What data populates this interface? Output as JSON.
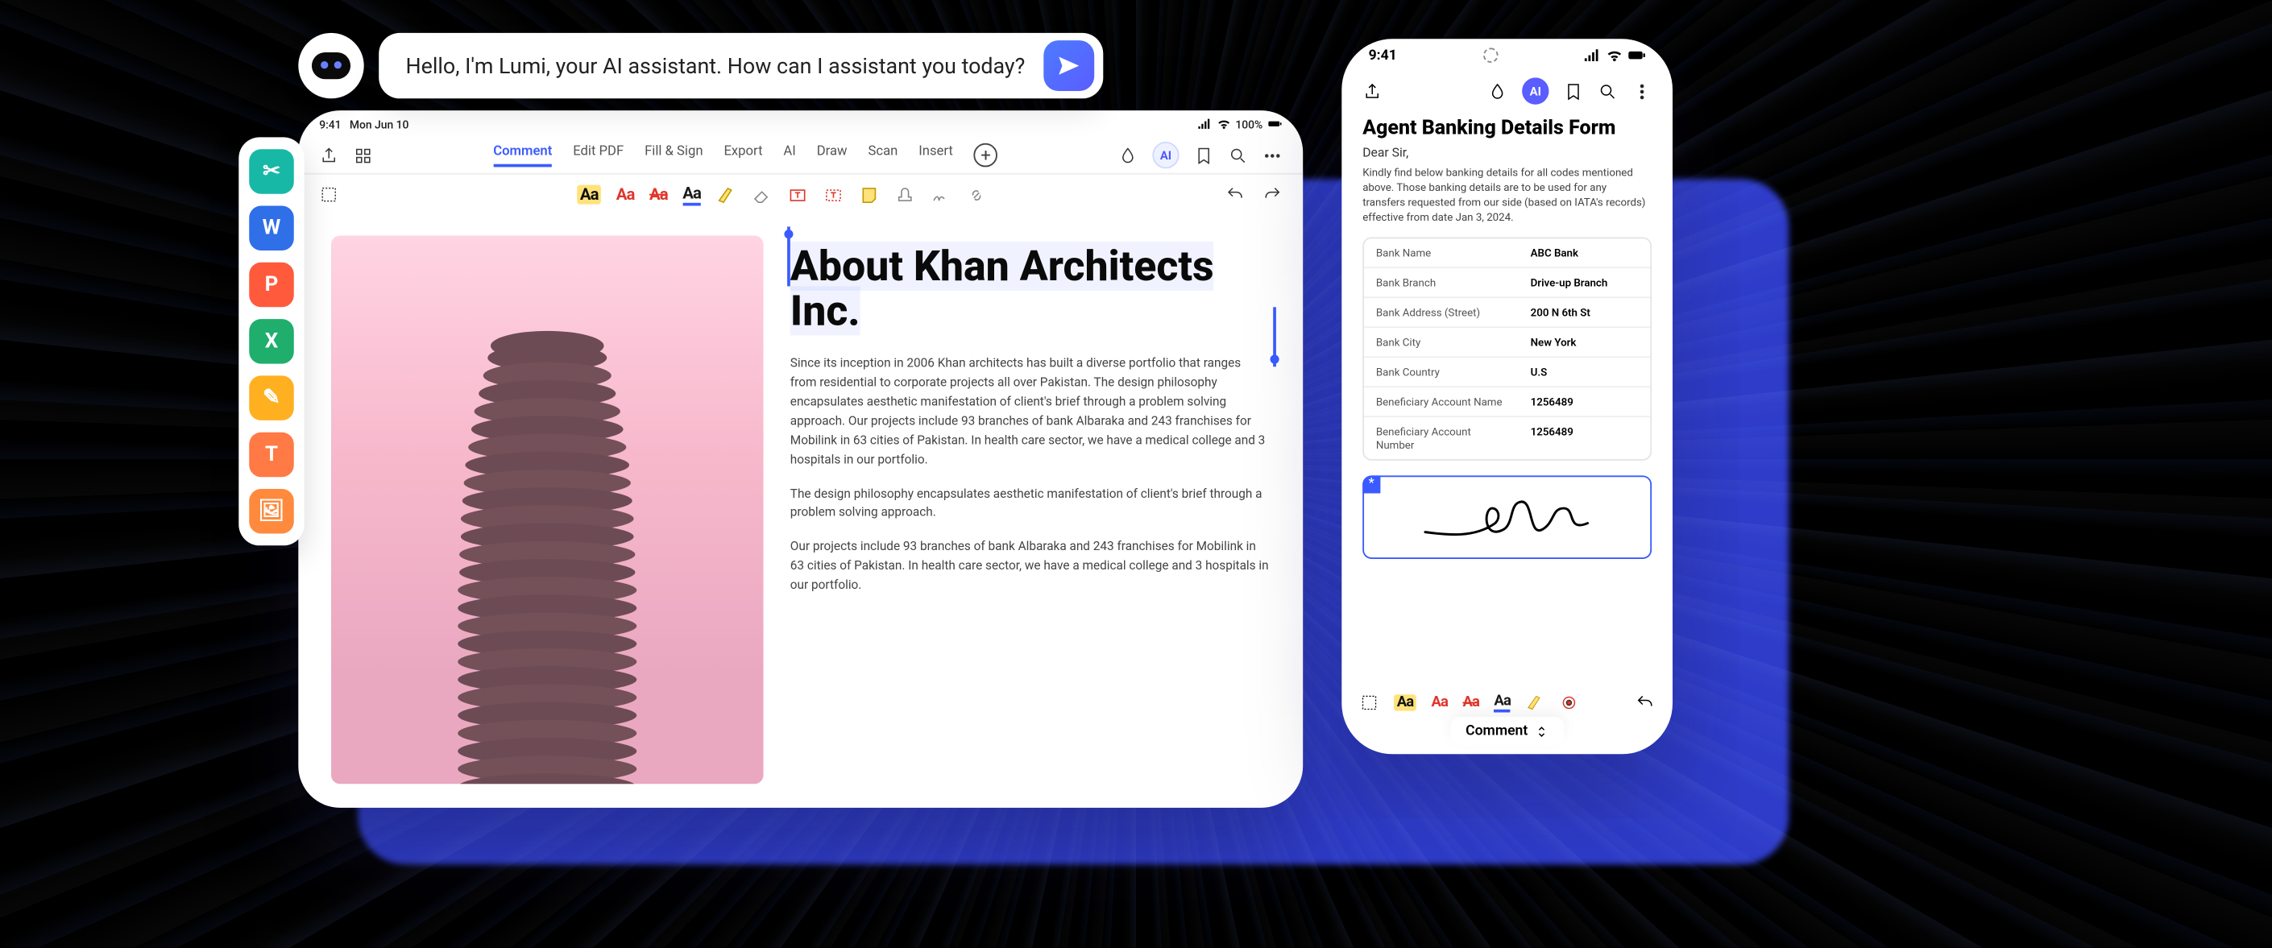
{
  "ai": {
    "greeting": "Hello, I'm Lumi, your AI assistant. How can I assistant you today?"
  },
  "dock": {
    "items": [
      {
        "label": "✂",
        "bg": "#17b8a6"
      },
      {
        "label": "W",
        "bg": "#2f6fe8"
      },
      {
        "label": "P",
        "bg": "#ff5a3c"
      },
      {
        "label": "X",
        "bg": "#1fae6c"
      },
      {
        "label": "✎",
        "bg": "#ffb021"
      },
      {
        "label": "T",
        "bg": "#ff7a45"
      },
      {
        "label": "🖼",
        "bg": "#ff8a3d"
      }
    ]
  },
  "tablet": {
    "status": {
      "time": "9:41",
      "date": "Mon Jun 10",
      "battery": "100%"
    },
    "header": {
      "tabs": [
        "Comment",
        "Edit PDF",
        "Fill & Sign",
        "Export",
        "AI",
        "Draw",
        "Scan",
        "Insert"
      ],
      "active_index": 0,
      "ai_badge": "AI"
    },
    "document": {
      "title": "About Khan Architects Inc.",
      "p1": "Since its inception in 2006 Khan architects has built a diverse portfolio that ranges from residential to corporate projects all over Pakistan. The design philosophy encapsulates aesthetic manifestation of client's brief through a problem solving approach. Our projects include 93 branches of bank Albaraka and 243 franchises for Mobilink in 63 cities of Pakistan. In health care sector, we have a medical college and 3 hospitals in our portfolio.",
      "p2": "The design philosophy encapsulates aesthetic manifestation of client's brief through a problem solving approach.",
      "p3": "Our projects include 93 branches of bank Albaraka and 243 franchises for Mobilink in 63 cities of Pakistan. In health care sector, we have a medical college and 3 hospitals in our portfolio."
    }
  },
  "phone": {
    "status_time": "9:41",
    "title": "Agent Banking Details Form",
    "dear": "Dear Sir,",
    "intro": "Kindly find below banking details for all codes mentioned above. Those banking details are to be used for any transfers requested from our side (based on IATA's records) effective from date Jan 3, 2024.",
    "table": [
      {
        "k": "Bank Name",
        "v": "ABC Bank"
      },
      {
        "k": "Bank Branch",
        "v": "Drive-up Branch"
      },
      {
        "k": "Bank Address (Street)",
        "v": "200 N 6th St"
      },
      {
        "k": "Bank City",
        "v": "New York"
      },
      {
        "k": "Bank Country",
        "v": "U.S"
      },
      {
        "k": "Beneficiary Account Name",
        "v": "1256489"
      },
      {
        "k": "Beneficiary Account Number",
        "v": "1256489"
      }
    ],
    "mode": "Comment",
    "ai_badge": "AI"
  }
}
